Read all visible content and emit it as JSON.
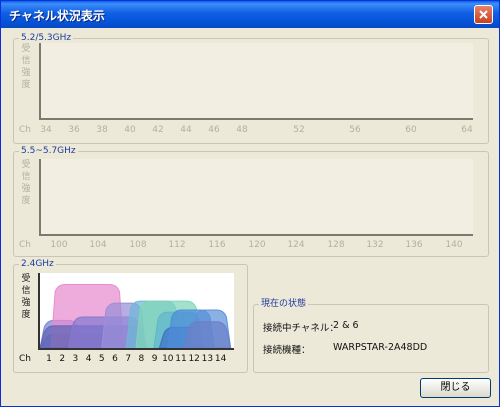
{
  "window": {
    "title": "チャネル状況表示"
  },
  "panels": {
    "band_52": {
      "label": "5.2/5.3GHz",
      "ylabel": "受信強度",
      "xlabel": "Ch",
      "ticks": [
        "34",
        "36",
        "38",
        "40",
        "42",
        "44",
        "46",
        "48",
        "52",
        "56",
        "60",
        "64"
      ]
    },
    "band_55": {
      "label": "5.5~5.7GHz",
      "ylabel": "受信強度",
      "xlabel": "Ch",
      "ticks": [
        "100",
        "104",
        "108",
        "112",
        "116",
        "120",
        "124",
        "128",
        "132",
        "136",
        "140"
      ]
    },
    "band_24": {
      "label": "2.4GHz",
      "ylabel": "受信強度",
      "xlabel": "Ch",
      "ticks": [
        "1",
        "2",
        "3",
        "4",
        "5",
        "6",
        "7",
        "8",
        "9",
        "10",
        "11",
        "12",
        "13",
        "14"
      ]
    }
  },
  "chart_data": [
    {
      "type": "area",
      "band": "5.2/5.3GHz",
      "ylabel": "受信強度",
      "xlabel": "Ch",
      "categories": [
        "34",
        "36",
        "38",
        "40",
        "42",
        "44",
        "46",
        "48",
        "52",
        "56",
        "60",
        "64"
      ],
      "series": []
    },
    {
      "type": "area",
      "band": "5.5~5.7GHz",
      "ylabel": "受信強度",
      "xlabel": "Ch",
      "categories": [
        "100",
        "104",
        "108",
        "112",
        "116",
        "120",
        "124",
        "128",
        "132",
        "136",
        "140"
      ],
      "series": []
    },
    {
      "type": "area",
      "band": "2.4GHz",
      "ylabel": "受信強度",
      "xlabel": "Ch",
      "xlim": [
        0.5,
        14.5
      ],
      "ylim": [
        0,
        100
      ],
      "series": [
        {
          "channel": 1,
          "from": 0.5,
          "to": 3.6,
          "level": 40,
          "color": "#7b82d6"
        },
        {
          "channel": 2,
          "from": 0.5,
          "to": 6.6,
          "level": 20,
          "color": "#6e78c8"
        },
        {
          "channel": 3,
          "from": 1.3,
          "to": 6.6,
          "level": 92,
          "color": "#e78cd0"
        },
        {
          "channel": 4,
          "from": 0.5,
          "to": 8.3,
          "level": 32,
          "color": "#6064b4"
        },
        {
          "channel": 5,
          "from": 2.6,
          "to": 8.0,
          "level": 45,
          "color": "#8479d0"
        },
        {
          "channel": 6,
          "from": 5.0,
          "to": 8.2,
          "level": 65,
          "color": "#9a8fd8"
        },
        {
          "channel": 7,
          "from": 6.8,
          "to": 10.7,
          "level": 68,
          "color": "#6db9d6"
        },
        {
          "channel": 8,
          "from": 7.5,
          "to": 12.2,
          "level": 68,
          "color": "#7fd6b8"
        },
        {
          "channel": 9,
          "from": 8.8,
          "to": 12.4,
          "level": 52,
          "color": "#5fb7cc"
        },
        {
          "channel": 10,
          "from": 9.2,
          "to": 12.4,
          "level": 30,
          "color": "#3f70c8"
        },
        {
          "channel": 11,
          "from": 9.8,
          "to": 13.2,
          "level": 55,
          "color": "#4d8ed8"
        },
        {
          "channel": 12,
          "from": 11.5,
          "to": 14.4,
          "level": 55,
          "color": "#5d92da"
        },
        {
          "channel": 13,
          "from": 11.0,
          "to": 14.4,
          "level": 38,
          "color": "#6c7fc8"
        }
      ]
    }
  ],
  "status": {
    "title": "現在の状態",
    "connected_channel_label": "接続中チャネル：",
    "connected_channel_value": "2 & 6",
    "connected_device_label": "接続機種：",
    "connected_device_value": "WARPSTAR-2A48DD"
  },
  "buttons": {
    "close_label": "閉じる"
  }
}
